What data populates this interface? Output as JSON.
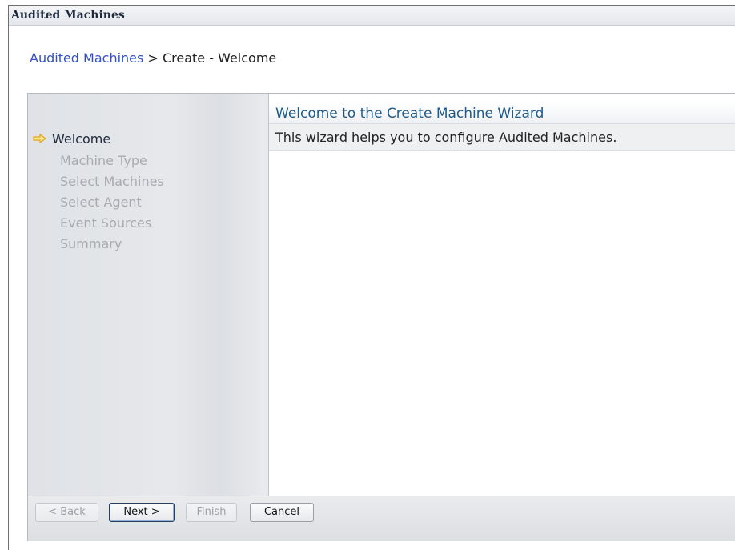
{
  "window": {
    "title": "Audited Machines"
  },
  "breadcrumb": {
    "link": "Audited Machines",
    "separator": ">",
    "current": "Create - Welcome"
  },
  "wizard": {
    "steps": [
      {
        "label": "Welcome",
        "current": true
      },
      {
        "label": "Machine Type",
        "current": false
      },
      {
        "label": "Select Machines",
        "current": false
      },
      {
        "label": "Select Agent",
        "current": false
      },
      {
        "label": "Event Sources",
        "current": false
      },
      {
        "label": "Summary",
        "current": false
      }
    ],
    "current_step_icon": "right-arrow-icon",
    "content_title": "Welcome to the Create Machine Wizard",
    "content_description": "This wizard helps you to configure Audited Machines."
  },
  "buttons": {
    "back": {
      "label": "< Back",
      "enabled": false
    },
    "next": {
      "label": "Next >",
      "enabled": true
    },
    "finish": {
      "label": "Finish",
      "enabled": false
    },
    "cancel": {
      "label": "Cancel",
      "enabled": true
    }
  },
  "colors": {
    "link": "#3452c8",
    "title_accent": "#1e5b8a",
    "arrow": "#f0b323",
    "disabled_text": "#a7abb1"
  }
}
